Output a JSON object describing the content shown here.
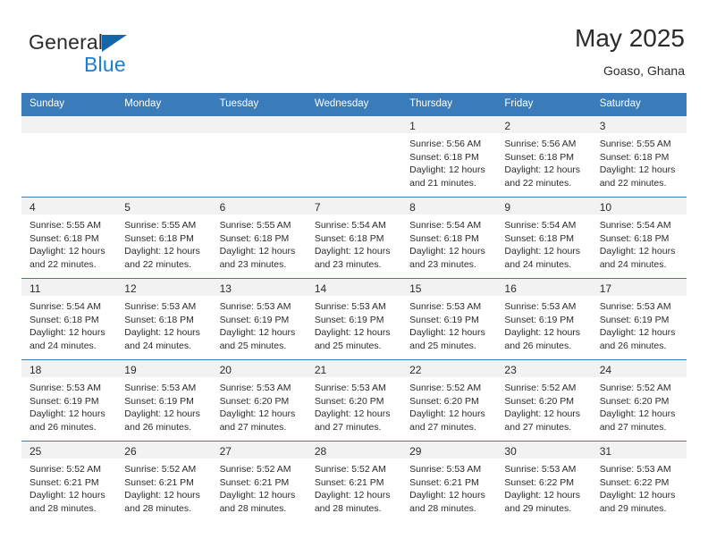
{
  "brand": {
    "name_top": "General",
    "name_bottom": "Blue",
    "triangle_color": "#1565a8",
    "blue_text_color": "#1a7fd4"
  },
  "header": {
    "title": "May 2025",
    "subtitle": "Goaso, Ghana"
  },
  "theme": {
    "header_blue": "#3a7cb9",
    "daynum_band": "#f2f2f2",
    "text": "#2b2b2b"
  },
  "weekday_headers": [
    "Sunday",
    "Monday",
    "Tuesday",
    "Wednesday",
    "Thursday",
    "Friday",
    "Saturday"
  ],
  "weeks": [
    [
      {
        "day": "",
        "sunrise": "",
        "sunset": "",
        "daylight_line1": "",
        "daylight_line2": ""
      },
      {
        "day": "",
        "sunrise": "",
        "sunset": "",
        "daylight_line1": "",
        "daylight_line2": ""
      },
      {
        "day": "",
        "sunrise": "",
        "sunset": "",
        "daylight_line1": "",
        "daylight_line2": ""
      },
      {
        "day": "",
        "sunrise": "",
        "sunset": "",
        "daylight_line1": "",
        "daylight_line2": ""
      },
      {
        "day": "1",
        "sunrise": "Sunrise: 5:56 AM",
        "sunset": "Sunset: 6:18 PM",
        "daylight_line1": "Daylight: 12 hours",
        "daylight_line2": "and 21 minutes."
      },
      {
        "day": "2",
        "sunrise": "Sunrise: 5:56 AM",
        "sunset": "Sunset: 6:18 PM",
        "daylight_line1": "Daylight: 12 hours",
        "daylight_line2": "and 22 minutes."
      },
      {
        "day": "3",
        "sunrise": "Sunrise: 5:55 AM",
        "sunset": "Sunset: 6:18 PM",
        "daylight_line1": "Daylight: 12 hours",
        "daylight_line2": "and 22 minutes."
      }
    ],
    [
      {
        "day": "4",
        "sunrise": "Sunrise: 5:55 AM",
        "sunset": "Sunset: 6:18 PM",
        "daylight_line1": "Daylight: 12 hours",
        "daylight_line2": "and 22 minutes."
      },
      {
        "day": "5",
        "sunrise": "Sunrise: 5:55 AM",
        "sunset": "Sunset: 6:18 PM",
        "daylight_line1": "Daylight: 12 hours",
        "daylight_line2": "and 22 minutes."
      },
      {
        "day": "6",
        "sunrise": "Sunrise: 5:55 AM",
        "sunset": "Sunset: 6:18 PM",
        "daylight_line1": "Daylight: 12 hours",
        "daylight_line2": "and 23 minutes."
      },
      {
        "day": "7",
        "sunrise": "Sunrise: 5:54 AM",
        "sunset": "Sunset: 6:18 PM",
        "daylight_line1": "Daylight: 12 hours",
        "daylight_line2": "and 23 minutes."
      },
      {
        "day": "8",
        "sunrise": "Sunrise: 5:54 AM",
        "sunset": "Sunset: 6:18 PM",
        "daylight_line1": "Daylight: 12 hours",
        "daylight_line2": "and 23 minutes."
      },
      {
        "day": "9",
        "sunrise": "Sunrise: 5:54 AM",
        "sunset": "Sunset: 6:18 PM",
        "daylight_line1": "Daylight: 12 hours",
        "daylight_line2": "and 24 minutes."
      },
      {
        "day": "10",
        "sunrise": "Sunrise: 5:54 AM",
        "sunset": "Sunset: 6:18 PM",
        "daylight_line1": "Daylight: 12 hours",
        "daylight_line2": "and 24 minutes."
      }
    ],
    [
      {
        "day": "11",
        "sunrise": "Sunrise: 5:54 AM",
        "sunset": "Sunset: 6:18 PM",
        "daylight_line1": "Daylight: 12 hours",
        "daylight_line2": "and 24 minutes."
      },
      {
        "day": "12",
        "sunrise": "Sunrise: 5:53 AM",
        "sunset": "Sunset: 6:18 PM",
        "daylight_line1": "Daylight: 12 hours",
        "daylight_line2": "and 24 minutes."
      },
      {
        "day": "13",
        "sunrise": "Sunrise: 5:53 AM",
        "sunset": "Sunset: 6:19 PM",
        "daylight_line1": "Daylight: 12 hours",
        "daylight_line2": "and 25 minutes."
      },
      {
        "day": "14",
        "sunrise": "Sunrise: 5:53 AM",
        "sunset": "Sunset: 6:19 PM",
        "daylight_line1": "Daylight: 12 hours",
        "daylight_line2": "and 25 minutes."
      },
      {
        "day": "15",
        "sunrise": "Sunrise: 5:53 AM",
        "sunset": "Sunset: 6:19 PM",
        "daylight_line1": "Daylight: 12 hours",
        "daylight_line2": "and 25 minutes."
      },
      {
        "day": "16",
        "sunrise": "Sunrise: 5:53 AM",
        "sunset": "Sunset: 6:19 PM",
        "daylight_line1": "Daylight: 12 hours",
        "daylight_line2": "and 26 minutes."
      },
      {
        "day": "17",
        "sunrise": "Sunrise: 5:53 AM",
        "sunset": "Sunset: 6:19 PM",
        "daylight_line1": "Daylight: 12 hours",
        "daylight_line2": "and 26 minutes."
      }
    ],
    [
      {
        "day": "18",
        "sunrise": "Sunrise: 5:53 AM",
        "sunset": "Sunset: 6:19 PM",
        "daylight_line1": "Daylight: 12 hours",
        "daylight_line2": "and 26 minutes."
      },
      {
        "day": "19",
        "sunrise": "Sunrise: 5:53 AM",
        "sunset": "Sunset: 6:19 PM",
        "daylight_line1": "Daylight: 12 hours",
        "daylight_line2": "and 26 minutes."
      },
      {
        "day": "20",
        "sunrise": "Sunrise: 5:53 AM",
        "sunset": "Sunset: 6:20 PM",
        "daylight_line1": "Daylight: 12 hours",
        "daylight_line2": "and 27 minutes."
      },
      {
        "day": "21",
        "sunrise": "Sunrise: 5:53 AM",
        "sunset": "Sunset: 6:20 PM",
        "daylight_line1": "Daylight: 12 hours",
        "daylight_line2": "and 27 minutes."
      },
      {
        "day": "22",
        "sunrise": "Sunrise: 5:52 AM",
        "sunset": "Sunset: 6:20 PM",
        "daylight_line1": "Daylight: 12 hours",
        "daylight_line2": "and 27 minutes."
      },
      {
        "day": "23",
        "sunrise": "Sunrise: 5:52 AM",
        "sunset": "Sunset: 6:20 PM",
        "daylight_line1": "Daylight: 12 hours",
        "daylight_line2": "and 27 minutes."
      },
      {
        "day": "24",
        "sunrise": "Sunrise: 5:52 AM",
        "sunset": "Sunset: 6:20 PM",
        "daylight_line1": "Daylight: 12 hours",
        "daylight_line2": "and 27 minutes."
      }
    ],
    [
      {
        "day": "25",
        "sunrise": "Sunrise: 5:52 AM",
        "sunset": "Sunset: 6:21 PM",
        "daylight_line1": "Daylight: 12 hours",
        "daylight_line2": "and 28 minutes."
      },
      {
        "day": "26",
        "sunrise": "Sunrise: 5:52 AM",
        "sunset": "Sunset: 6:21 PM",
        "daylight_line1": "Daylight: 12 hours",
        "daylight_line2": "and 28 minutes."
      },
      {
        "day": "27",
        "sunrise": "Sunrise: 5:52 AM",
        "sunset": "Sunset: 6:21 PM",
        "daylight_line1": "Daylight: 12 hours",
        "daylight_line2": "and 28 minutes."
      },
      {
        "day": "28",
        "sunrise": "Sunrise: 5:52 AM",
        "sunset": "Sunset: 6:21 PM",
        "daylight_line1": "Daylight: 12 hours",
        "daylight_line2": "and 28 minutes."
      },
      {
        "day": "29",
        "sunrise": "Sunrise: 5:53 AM",
        "sunset": "Sunset: 6:21 PM",
        "daylight_line1": "Daylight: 12 hours",
        "daylight_line2": "and 28 minutes."
      },
      {
        "day": "30",
        "sunrise": "Sunrise: 5:53 AM",
        "sunset": "Sunset: 6:22 PM",
        "daylight_line1": "Daylight: 12 hours",
        "daylight_line2": "and 29 minutes."
      },
      {
        "day": "31",
        "sunrise": "Sunrise: 5:53 AM",
        "sunset": "Sunset: 6:22 PM",
        "daylight_line1": "Daylight: 12 hours",
        "daylight_line2": "and 29 minutes."
      }
    ]
  ]
}
